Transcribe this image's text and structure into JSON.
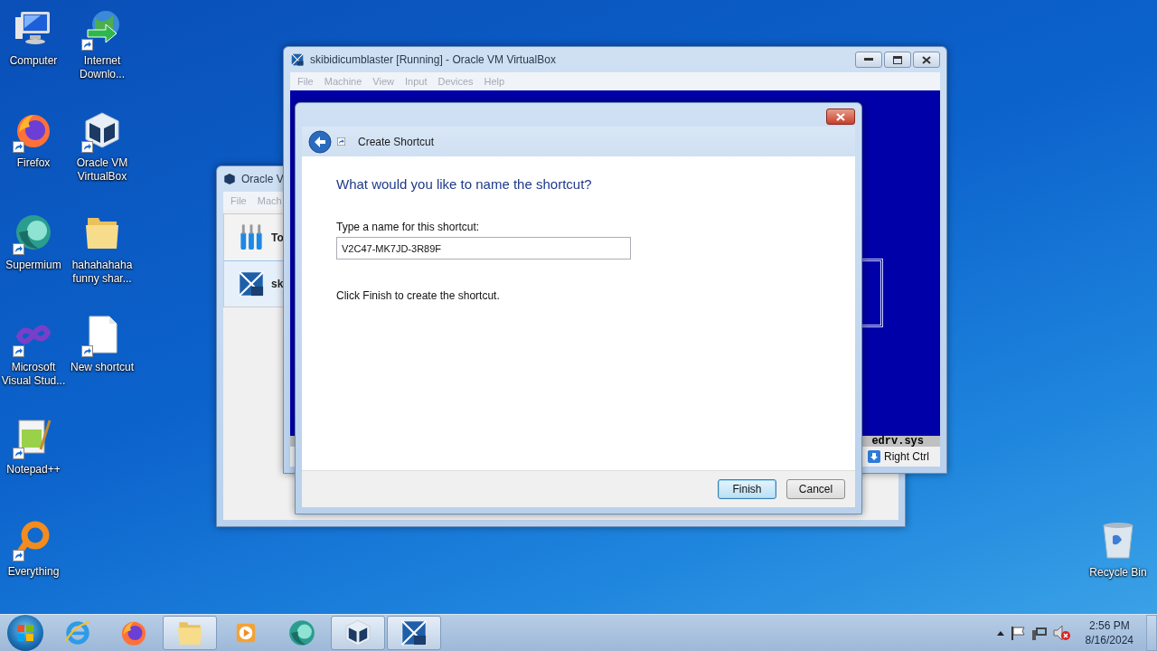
{
  "desktop_icons": [
    {
      "label": "Computer",
      "kind": "computer",
      "shortcut": false
    },
    {
      "label": "Firefox",
      "kind": "firefox",
      "shortcut": true
    },
    {
      "label": "Supermium",
      "kind": "supermium",
      "shortcut": true
    },
    {
      "label": "Microsoft Visual Stud...",
      "kind": "visualstudio",
      "shortcut": true
    },
    {
      "label": "Notepad++",
      "kind": "notepad",
      "shortcut": true
    },
    {
      "label": "Everything",
      "kind": "everything",
      "shortcut": true
    },
    {
      "label": "Internet Downlo...",
      "kind": "globe",
      "shortcut": true
    },
    {
      "label": "Oracle VM VirtualBox",
      "kind": "vbox",
      "shortcut": true
    },
    {
      "label": "hahahahaha funny shar...",
      "kind": "folder",
      "shortcut": false
    },
    {
      "label": "New shortcut",
      "kind": "file",
      "shortcut": true
    }
  ],
  "recycle_bin": {
    "label": "Recycle Bin"
  },
  "manager_window": {
    "title": "Oracle V",
    "menu": [
      "File",
      "Mach"
    ],
    "items": [
      {
        "label": "To",
        "kind": "tools",
        "selected": false
      },
      {
        "label": "sk",
        "kind": "vm",
        "selected": true
      }
    ]
  },
  "vm_window": {
    "title": "skibidicumblaster [Running] - Oracle VM VirtualBox",
    "menu": [
      "File",
      "Machine",
      "View",
      "Input",
      "Devices",
      "Help"
    ],
    "screen_text": "edrv.sys",
    "host_key": "Right Ctrl"
  },
  "dialog": {
    "title": "Create Shortcut",
    "heading": "What would you like to name the shortcut?",
    "field_label": "Type a name for this shortcut:",
    "field_value": "V2C47-MK7JD-3R89F",
    "hint": "Click Finish to create the shortcut.",
    "buttons": [
      {
        "label": "Finish",
        "default": true
      },
      {
        "label": "Cancel",
        "default": false
      }
    ]
  },
  "taskbar": {
    "items": [
      {
        "kind": "ie",
        "open": false
      },
      {
        "kind": "firefox",
        "open": false
      },
      {
        "kind": "folder",
        "open": true
      },
      {
        "kind": "media",
        "open": false
      },
      {
        "kind": "supermium",
        "open": false
      },
      {
        "kind": "vbox",
        "open": true
      },
      {
        "kind": "xp",
        "open": true
      }
    ],
    "clock": {
      "time": "2:56 PM",
      "date": "8/16/2024"
    }
  }
}
